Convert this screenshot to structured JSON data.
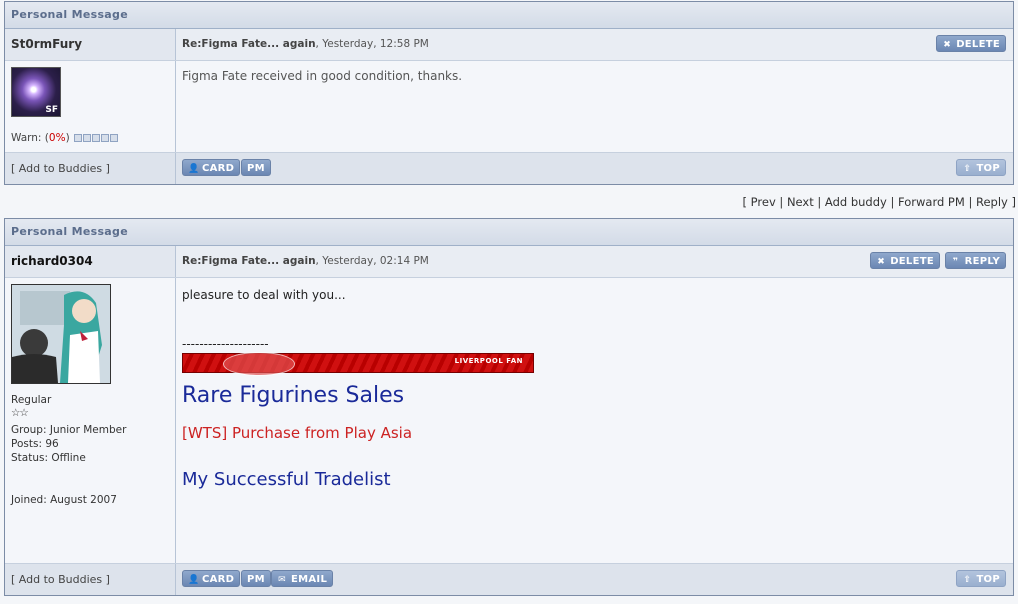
{
  "messages": [
    {
      "header": "Personal Message",
      "username": "St0rmFury",
      "subject": "Re:Figma Fate... again",
      "date": ", Yesterday, 12:58 PM",
      "body": "Figma Fate received in good condition, thanks.",
      "avatar_badge": "SF",
      "warn_label": "Warn: (",
      "warn_pct": "0%",
      "warn_close": ")",
      "add_buddies": "[ Add to Buddies ]",
      "buttons": {
        "delete": "DELETE",
        "card": "CARD",
        "pm": "PM",
        "top": "TOP"
      }
    },
    {
      "header": "Personal Message",
      "username": "richard0304",
      "subject": "Re:Figma Fate... again",
      "date": ", Yesterday, 02:14 PM",
      "body": "pleasure to deal with you...",
      "separator": "--------------------",
      "rank": "Regular",
      "group": "Group: Junior Member",
      "posts": "Posts: 96",
      "status": "Status: Offline",
      "joined": "Joined: August 2007",
      "banner_text": "LIVERPOOL FAN",
      "sig_title": "Rare Figurines Sales",
      "sig_wts": "[WTS] Purchase from Play Asia",
      "sig_trade": "My Successful Tradelist",
      "add_buddies": "[ Add to Buddies ]",
      "buttons": {
        "delete": "DELETE",
        "reply": "REPLY",
        "card": "CARD",
        "pm": "PM",
        "email": "EMAIL",
        "top": "TOP"
      }
    }
  ],
  "nav": {
    "prev": "Prev",
    "next": "Next",
    "add_buddy": "Add buddy",
    "forward": "Forward PM",
    "reply": "Reply"
  },
  "colors": {
    "header_text": "#5b6d8c",
    "button": "#6b87b3",
    "sig_title": "#1a2a99",
    "sig_wts": "#cc2222",
    "warn_pct": "#cc0000"
  },
  "icons": [
    "x-icon",
    "user-icon",
    "envelope-icon",
    "arrow-up-icon",
    "quote-icon",
    "star-icon"
  ]
}
